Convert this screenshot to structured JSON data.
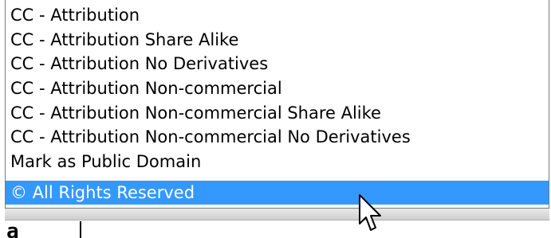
{
  "license_dropdown": {
    "options": [
      {
        "label": "CC - Attribution",
        "selected": false
      },
      {
        "label": "CC - Attribution Share Alike",
        "selected": false
      },
      {
        "label": "CC - Attribution No Derivatives",
        "selected": false
      },
      {
        "label": "CC - Attribution Non-commercial",
        "selected": false
      },
      {
        "label": "CC - Attribution Non-commercial Share Alike",
        "selected": false
      },
      {
        "label": "CC - Attribution Non-commercial No Derivatives",
        "selected": false
      },
      {
        "label": "Mark as Public Domain",
        "selected": false
      },
      {
        "label": "© All Rights Reserved",
        "selected": true
      }
    ]
  },
  "background": {
    "fragment_text": "a"
  },
  "colors": {
    "highlight": "#3399ff",
    "highlight_text": "#ffffff",
    "text": "#000000"
  },
  "cursor": {
    "icon": "arrow-pointer-icon"
  }
}
